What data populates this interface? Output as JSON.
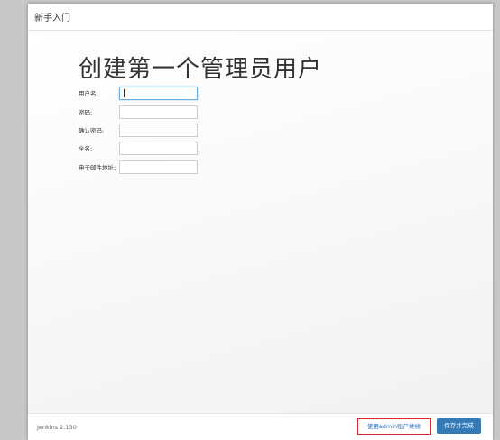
{
  "dialog": {
    "title": "新手入门",
    "heading": "创建第一个管理员用户"
  },
  "form": {
    "fields": [
      {
        "label": "用户名:",
        "value": ""
      },
      {
        "label": "密码:",
        "value": ""
      },
      {
        "label": "确认密码:",
        "value": ""
      },
      {
        "label": "全名:",
        "value": ""
      },
      {
        "label": "电子邮件地址:",
        "value": ""
      }
    ]
  },
  "footer": {
    "version": "Jenkins 2.130",
    "admin_link_label": "使用admin账户继续",
    "save_label": "保存并完成"
  },
  "colors": {
    "primary": "#337ab7",
    "highlight_border": "#e02828",
    "link": "#2a6ebd",
    "focus": "#66afe9"
  }
}
